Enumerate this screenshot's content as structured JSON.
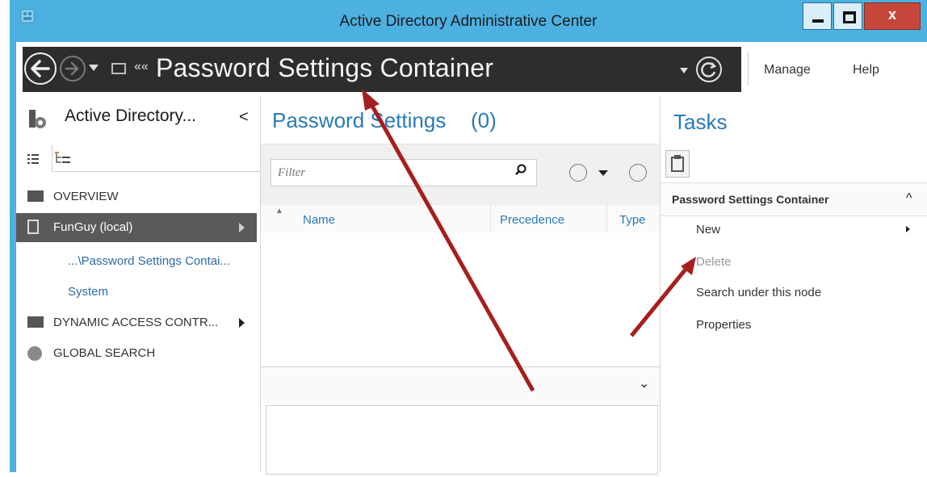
{
  "window": {
    "title": "Active Directory Administrative Center",
    "close_label": "x"
  },
  "navbar": {
    "breadcrumb_prefix": "««",
    "breadcrumb": "Password Settings Container",
    "menu": {
      "manage": "Manage",
      "help": "Help"
    }
  },
  "left": {
    "title": "Active Directory...",
    "collapse": "<",
    "items": [
      {
        "label": "OVERVIEW"
      },
      {
        "label": "FunGuy (local)"
      },
      {
        "label": "...\\Password Settings Contai..."
      },
      {
        "label": "System"
      },
      {
        "label": "DYNAMIC ACCESS CONTR..."
      },
      {
        "label": "GLOBAL SEARCH"
      }
    ]
  },
  "main": {
    "title": "Password Settings",
    "count": "(0)",
    "filter": {
      "placeholder": "Filter"
    },
    "columns": [
      "Name",
      "Precedence",
      "Type"
    ]
  },
  "tasks": {
    "title": "Tasks",
    "section": "Password Settings Container",
    "items": [
      "New",
      "Delete",
      "Search under this node",
      "Properties"
    ]
  },
  "colors": {
    "frame": "#4cb1e1",
    "accent": "#2a7ab5",
    "breadcrumb_bg": "#2d2d2d",
    "annotation_arrow": "#a61e1e"
  }
}
